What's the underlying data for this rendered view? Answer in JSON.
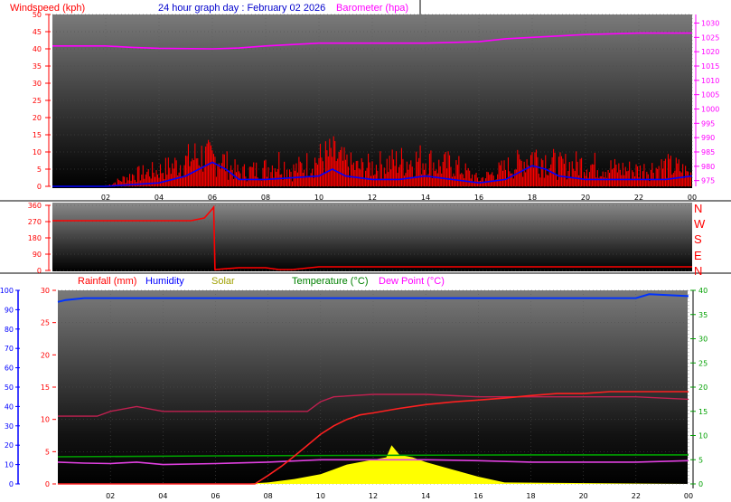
{
  "header": {
    "windspeed_label": "Windspeed (kph)",
    "title": "24 hour graph day : February 02 2026",
    "barometer_label": "Barometer (hpa)"
  },
  "bottom_legend": {
    "rainfall": "Rainfall (mm)",
    "humidity": "Humidity",
    "solar": "Solar",
    "temperature": "Temperature (°C)",
    "dewpoint": "Dew Point (°C)"
  },
  "wind_dir_labels": [
    "N",
    "W",
    "S",
    "E",
    "N"
  ],
  "colors": {
    "background": "#000000",
    "wind": "#ff0000",
    "gust": "#0000ff",
    "barometer": "#ff00ff",
    "direction": "#ff0000",
    "rain": "#ff2020",
    "humidity": "#0033ff",
    "solar": "#ffff00",
    "temperature": "#00a000",
    "dewpoint": "#e040e0",
    "heat": "#c02050"
  },
  "chart_data": [
    {
      "id": "wind_baro",
      "type": "line",
      "title": "24 hour graph day : February 02 2026",
      "x_ticks": [
        "02",
        "04",
        "06",
        "08",
        "10",
        "12",
        "14",
        "16",
        "18",
        "20",
        "22",
        "00"
      ],
      "y_left": {
        "label": "Windspeed (kph)",
        "ticks": [
          0,
          5,
          10,
          15,
          20,
          25,
          30,
          35,
          40,
          45,
          50
        ],
        "ylim": [
          0,
          50
        ]
      },
      "y_right": {
        "label": "Barometer (hpa)",
        "ticks": [
          975,
          980,
          985,
          990,
          995,
          1000,
          1005,
          1010,
          1015,
          1020,
          1025,
          1030
        ],
        "ylim": [
          973,
          1033
        ]
      },
      "series": [
        {
          "name": "Windspeed (kph)",
          "axis": "left",
          "x": [
            0,
            2,
            3,
            4,
            4.5,
            5,
            5.5,
            6,
            6.3,
            6.5,
            7,
            8,
            8.5,
            9,
            10,
            10.5,
            11,
            11.5,
            12,
            12.5,
            13,
            14,
            14.5,
            15,
            16,
            17,
            17.5,
            18,
            18.5,
            19,
            20,
            21,
            22,
            23,
            23.5,
            24
          ],
          "y": [
            0,
            0,
            5,
            7,
            9,
            11,
            14,
            12,
            13,
            10,
            6,
            8,
            11,
            7,
            12,
            14,
            10,
            8,
            9,
            10,
            11,
            12,
            9,
            10,
            3,
            8,
            10,
            14,
            12,
            9,
            10,
            8,
            7,
            9,
            8,
            5
          ]
        },
        {
          "name": "Gust",
          "axis": "left",
          "x": [
            0,
            2,
            4,
            5,
            6,
            6.5,
            7,
            8,
            10,
            10.5,
            11,
            12,
            13,
            14,
            15,
            16,
            17,
            18,
            18.5,
            19,
            20,
            21,
            22,
            23,
            24
          ],
          "y": [
            0,
            0,
            1,
            3,
            7,
            5,
            2,
            2,
            3,
            5,
            3,
            2,
            2,
            3,
            2,
            1,
            2,
            6,
            5,
            3,
            2,
            2,
            2,
            2,
            3
          ]
        },
        {
          "name": "Barometer (hpa)",
          "axis": "right",
          "x": [
            0,
            2,
            3,
            4,
            6,
            7,
            8,
            10,
            12,
            14,
            16,
            17,
            18,
            20,
            22,
            24
          ],
          "y": [
            1022,
            1022,
            1021.5,
            1021.2,
            1021,
            1021.3,
            1022,
            1023,
            1023,
            1023,
            1023.5,
            1024.5,
            1025,
            1026,
            1026.5,
            1026.5
          ]
        }
      ]
    },
    {
      "id": "wind_direction",
      "type": "line",
      "x_ticks": [
        "02",
        "04",
        "06",
        "08",
        "10",
        "12",
        "14",
        "16",
        "18",
        "20",
        "22",
        "00"
      ],
      "y_left": {
        "ticks": [
          0,
          90,
          180,
          270,
          360
        ],
        "ylim": [
          0,
          360
        ]
      },
      "y_right_labels": [
        "N",
        "W",
        "S",
        "E",
        "N"
      ],
      "series": [
        {
          "name": "Wind direction",
          "x": [
            0,
            5.2,
            5.7,
            6,
            6.05,
            6.1,
            7,
            8,
            8.5,
            9,
            10,
            11,
            14,
            18,
            24
          ],
          "y": [
            275,
            275,
            290,
            340,
            350,
            5,
            15,
            15,
            5,
            5,
            20,
            20,
            20,
            20,
            20
          ]
        }
      ]
    },
    {
      "id": "rain_temp",
      "type": "line",
      "x_ticks": [
        "02",
        "04",
        "06",
        "08",
        "10",
        "12",
        "14",
        "16",
        "18",
        "20",
        "22",
        "00"
      ],
      "y_far_left": {
        "label": "Humidity",
        "ticks": [
          0,
          10,
          20,
          30,
          40,
          50,
          60,
          70,
          80,
          90,
          100
        ],
        "ylim": [
          0,
          100
        ]
      },
      "y_left": {
        "label": "Rainfall (mm)",
        "ticks": [
          0,
          5,
          10,
          15,
          20,
          25,
          30
        ],
        "ylim": [
          0,
          30
        ]
      },
      "y_right": {
        "label": "Temperature (°C)",
        "ticks": [
          0,
          5,
          10,
          15,
          20,
          25,
          30,
          35,
          40
        ],
        "ylim": [
          0,
          40
        ]
      },
      "series": [
        {
          "name": "Humidity",
          "axis": "far_left",
          "x": [
            0,
            0.3,
            1,
            3,
            6,
            10,
            14,
            18,
            22,
            22.5,
            24
          ],
          "y": [
            94,
            95,
            96,
            96,
            96,
            96,
            96,
            96,
            96,
            98,
            97
          ]
        },
        {
          "name": "Rainfall (mm)",
          "axis": "left",
          "x": [
            0,
            7.5,
            8,
            8.5,
            9,
            9.5,
            10,
            10.5,
            11,
            11.5,
            12,
            13,
            14,
            15,
            16,
            17,
            18,
            19,
            20,
            21,
            22,
            24
          ],
          "y": [
            0,
            0,
            1.3,
            2.7,
            4.3,
            6,
            7.7,
            9,
            10,
            10.7,
            11,
            11.7,
            12.3,
            12.7,
            13,
            13.3,
            13.7,
            14,
            14,
            14.3,
            14.3,
            14.3
          ]
        },
        {
          "name": "Solar",
          "axis": "right",
          "x": [
            0,
            7,
            8,
            9,
            10,
            10.5,
            11,
            11.5,
            12,
            12.5,
            12.7,
            13,
            13.5,
            14,
            15,
            16,
            17,
            24
          ],
          "y": [
            0,
            0,
            0.3,
            1,
            2,
            3,
            4,
            4.5,
            5,
            5.5,
            8,
            6,
            5.5,
            4.5,
            3,
            1.5,
            0.3,
            0
          ]
        },
        {
          "name": "Temperature (°C)",
          "axis": "right",
          "x": [
            0,
            6,
            12,
            18,
            24
          ],
          "y": [
            5.6,
            5.8,
            5.9,
            6,
            6
          ]
        },
        {
          "name": "Dew Point (°C)",
          "axis": "right",
          "x": [
            0,
            1,
            2,
            3,
            4,
            6,
            8,
            10,
            12,
            14,
            16,
            18,
            20,
            22,
            24
          ],
          "y": [
            4.5,
            4.3,
            4.2,
            4.5,
            4,
            4.2,
            4.5,
            5,
            5,
            5,
            4.8,
            4.5,
            4.5,
            4.5,
            4.8
          ]
        },
        {
          "name": "Heat",
          "axis": "right",
          "x": [
            0,
            1.5,
            2,
            3,
            4,
            6,
            8,
            9.5,
            10,
            10.5,
            12,
            14,
            16,
            18,
            20,
            22,
            24
          ],
          "y": [
            14,
            14,
            15,
            16,
            15,
            15,
            15,
            15,
            17,
            18,
            18.5,
            18.5,
            18,
            18,
            18,
            18,
            17.5
          ]
        }
      ]
    }
  ]
}
